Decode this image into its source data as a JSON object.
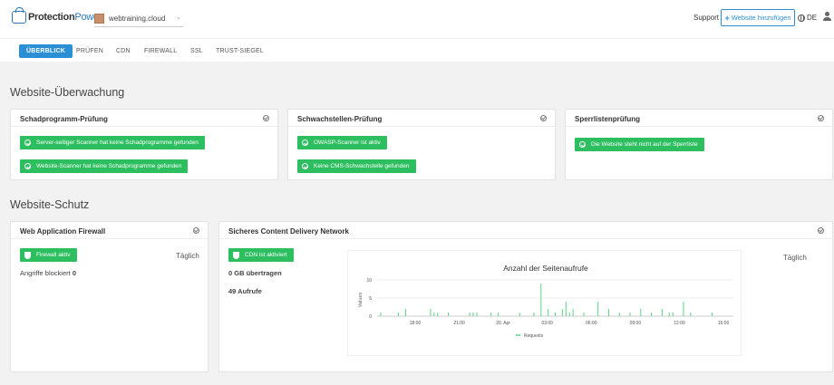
{
  "header": {
    "logo_part1": "Protection",
    "logo_part2": "Power",
    "site": "webtraining.cloud",
    "support": "Support",
    "add_website": "Website hinzufügen",
    "language": "DE"
  },
  "tabs": [
    {
      "label": "ÜBERBLICK"
    },
    {
      "label": "PRÜFEN"
    },
    {
      "label": "CDN"
    },
    {
      "label": "FIREWALL"
    },
    {
      "label": "SSL"
    },
    {
      "label": "TRUST-SIEGEL"
    }
  ],
  "monitoring": {
    "title": "Website-Überwachung",
    "malware": {
      "title": "Schadprogramm-Prüfung",
      "items": [
        "Server-seitiger Scanner hat keine Schadprogramme gefunden",
        "Website-Scanner hat keine Schadprogramme gefunden"
      ]
    },
    "vuln": {
      "title": "Schwachstellen-Prüfung",
      "items": [
        "OWASP-Scanner ist aktiv",
        "Keine CMS-Schwachstelle gefunden"
      ]
    },
    "blacklist": {
      "title": "Sperrlistenprüfung",
      "items": [
        "Die Website steht nicht auf der Sperrliste"
      ]
    }
  },
  "protection": {
    "title": "Website-Schutz",
    "waf": {
      "title": "Web Application Firewall",
      "status": "Firewall aktiv",
      "frequency": "Täglich",
      "blocked_label": "Angriffe blockiert",
      "blocked_value": "0"
    },
    "cdn": {
      "title": "Sicheres Content Delivery Network",
      "status": "CDN ist aktiviert",
      "transferred": "0 GB übertragen",
      "requests": "49 Aufrufe",
      "frequency": "Täglich"
    }
  },
  "colors": {
    "accent": "#2b8fd6",
    "success": "#2dbe60",
    "chart_line": "#5cd486"
  },
  "chart_data": {
    "type": "line",
    "title": "Anzahl der Seitenaufrufe",
    "ylabel": "Values",
    "xlabel": "",
    "ylim": [
      0,
      10
    ],
    "yticks": [
      0,
      5,
      10
    ],
    "xticks": [
      "18:00",
      "21:00",
      "20. Apr",
      "03:00",
      "06:00",
      "09:00",
      "12:00",
      "15:00"
    ],
    "series": [
      {
        "name": "Requests",
        "x": [
          1,
          6,
          8,
          15,
          16,
          17,
          20,
          26,
          27,
          28,
          32,
          34,
          40,
          44,
          46,
          48,
          50,
          52,
          53,
          54,
          55,
          58,
          62,
          65,
          68,
          71,
          74,
          77,
          80,
          82,
          83,
          86,
          88,
          94
        ],
        "values": [
          1,
          1,
          2,
          2,
          1,
          1,
          1,
          1,
          1,
          1,
          1,
          1,
          1,
          1,
          9,
          2,
          1,
          2,
          4,
          1,
          2,
          1,
          4,
          2,
          1,
          1,
          2,
          1,
          2,
          1,
          1,
          4,
          1,
          1
        ]
      }
    ]
  }
}
